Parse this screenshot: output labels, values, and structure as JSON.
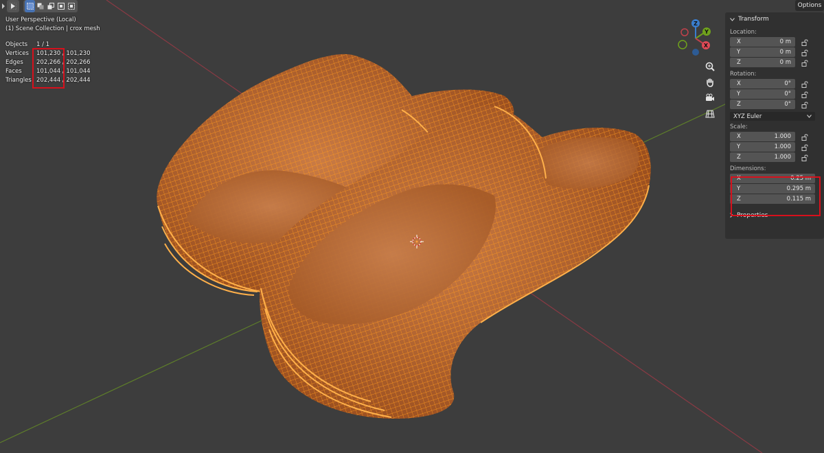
{
  "viewport": {
    "perspective": "User Perspective (Local)",
    "collection": "(1) Scene Collection | crox mesh"
  },
  "stats": [
    {
      "label": "Objects",
      "value": "1 / 1"
    },
    {
      "label": "Vertices",
      "value": "101,230 / 101,230"
    },
    {
      "label": "Edges",
      "value": "202,266 / 202,266"
    },
    {
      "label": "Faces",
      "value": "101,044 / 101,044"
    },
    {
      "label": "Triangles",
      "value": "202,444 / 202,444"
    }
  ],
  "header": {
    "options_label": "Options"
  },
  "gizmo": {
    "x": "X",
    "y": "Y",
    "z": "Z"
  },
  "npanel": {
    "transform_label": "Transform",
    "location_label": "Location:",
    "location": [
      {
        "axis": "X",
        "value": "0 m"
      },
      {
        "axis": "Y",
        "value": "0 m"
      },
      {
        "axis": "Z",
        "value": "0 m"
      }
    ],
    "rotation_label": "Rotation:",
    "rotation": [
      {
        "axis": "X",
        "value": "0°"
      },
      {
        "axis": "Y",
        "value": "0°"
      },
      {
        "axis": "Z",
        "value": "0°"
      }
    ],
    "rotation_mode": "XYZ Euler",
    "scale_label": "Scale:",
    "scale": [
      {
        "axis": "X",
        "value": "1.000"
      },
      {
        "axis": "Y",
        "value": "1.000"
      },
      {
        "axis": "Z",
        "value": "1.000"
      }
    ],
    "dimensions_label": "Dimensions:",
    "dimensions": [
      {
        "axis": "X",
        "value": "0.25 m"
      },
      {
        "axis": "Y",
        "value": "0.295 m"
      },
      {
        "axis": "Z",
        "value": "0.115 m"
      }
    ],
    "properties_label": "Properties"
  },
  "colors": {
    "background": "#3d3d3d",
    "mesh_fill": "#b5642a",
    "wire": "#ff9a1f",
    "axis_x": "#c2414b",
    "axis_y": "#70a21c",
    "axis_z": "#3a7ecf",
    "highlight": "#d8101c"
  }
}
